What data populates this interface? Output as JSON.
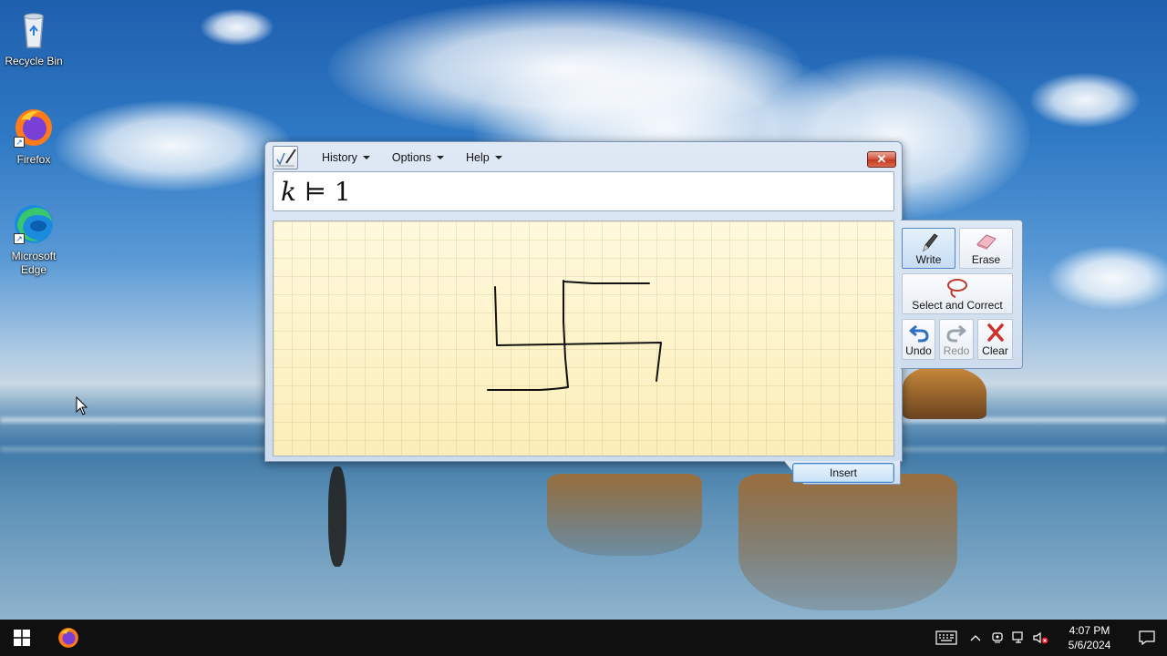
{
  "desktop": {
    "icons": [
      {
        "label": "Recycle Bin"
      },
      {
        "label": "Firefox"
      },
      {
        "label": "Microsoft Edge"
      }
    ]
  },
  "math_input_panel": {
    "menu": {
      "history": "History",
      "options": "Options",
      "help": "Help"
    },
    "close_label": "✕",
    "preview": {
      "variable": "k",
      "operator": "⊨",
      "value": "1"
    },
    "tools": {
      "write": "Write",
      "erase": "Erase",
      "select_correct": "Select and Correct",
      "undo": "Undo",
      "redo": "Redo",
      "clear": "Clear"
    },
    "insert": "Insert"
  },
  "taskbar": {
    "time": "4:07 PM",
    "date": "5/6/2024"
  },
  "colors": {
    "accent": "#4e86c8",
    "canvas": "#fdf3c8",
    "close": "#c13a22",
    "taskbar": "#101010"
  }
}
